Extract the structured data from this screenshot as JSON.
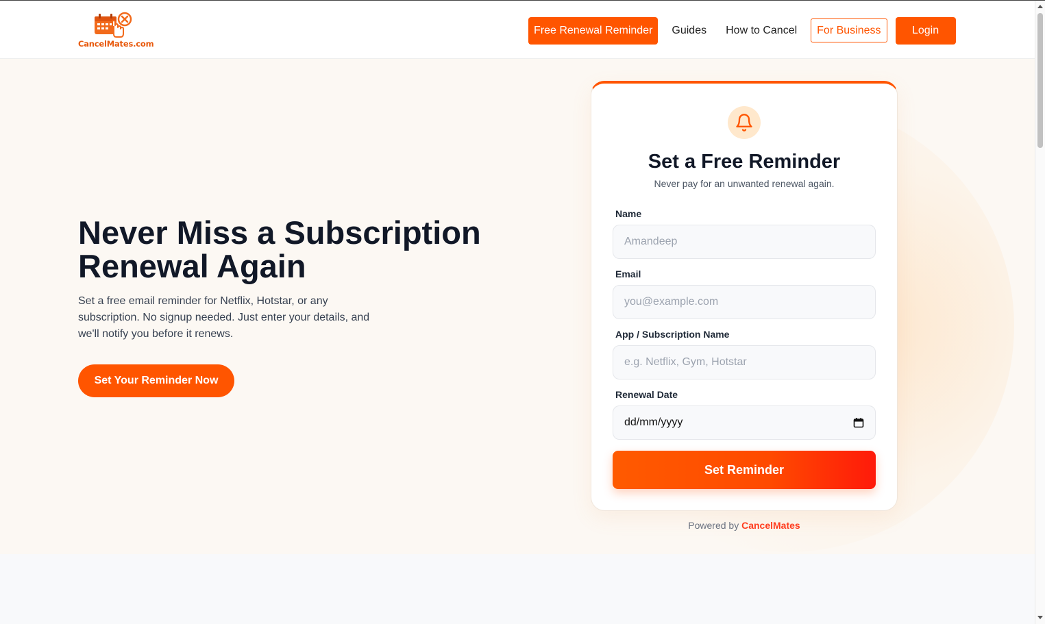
{
  "header": {
    "logo_text": "CancelMates.com",
    "nav": {
      "free_renewal_reminder": "Free Renewal Reminder",
      "guides": "Guides",
      "how_to_cancel": "How to Cancel",
      "for_business": "For Business",
      "login": "Login"
    }
  },
  "hero": {
    "title": "Never Miss a Subscription Renewal Again",
    "subtitle": "Set a free email reminder for Netflix, Hotstar, or any subscription. No signup needed. Just enter your details, and we'll notify you before it renews.",
    "cta": "Set Your Reminder Now"
  },
  "form": {
    "icon": "bell-icon",
    "title": "Set a Free Reminder",
    "subtitle": "Never pay for an unwanted renewal again.",
    "fields": {
      "name": {
        "label": "Name",
        "placeholder": "Amandeep"
      },
      "email": {
        "label": "Email",
        "placeholder": "you@example.com"
      },
      "app": {
        "label": "App / Subscription Name",
        "placeholder": "e.g. Netflix, Gym, Hotstar"
      },
      "date": {
        "label": "Renewal Date",
        "value": "dd/mm/yyyy"
      }
    },
    "submit": "Set Reminder",
    "powered_prefix": "Powered by",
    "powered_brand": "CancelMates"
  },
  "colors": {
    "accent": "#ff5500",
    "hero_bg": "#fcf8f3",
    "brand_red": "#ff3d1f"
  }
}
